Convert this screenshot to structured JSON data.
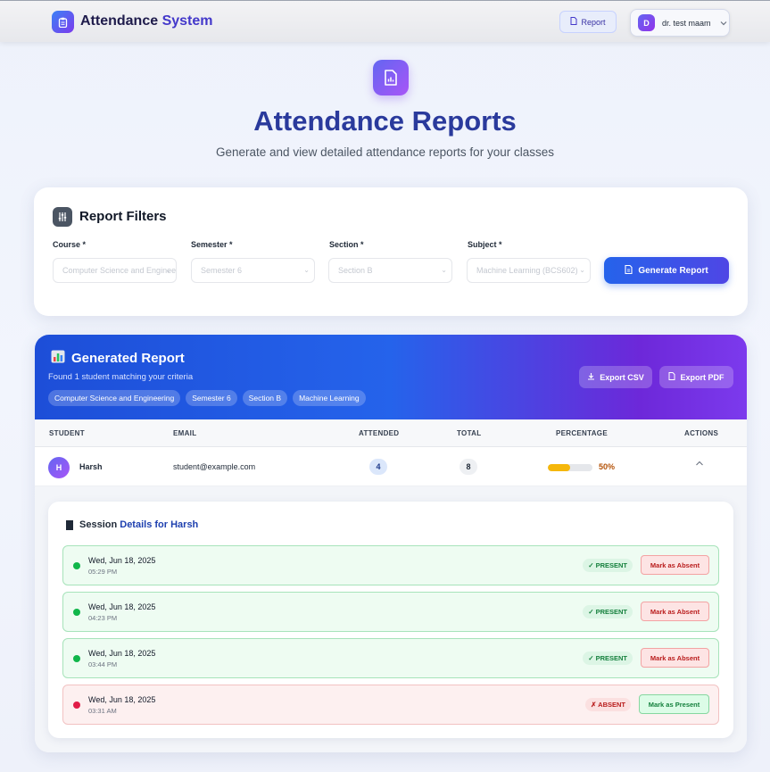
{
  "header": {
    "brand_part1": "Attendance",
    "brand_part2": "System",
    "report_button": "Report",
    "user_initial": "D",
    "user_name": "dr. test maam"
  },
  "hero": {
    "title": "Attendance Reports",
    "subtitle": "Generate and view detailed attendance reports for your classes"
  },
  "filters": {
    "title": "Report Filters",
    "fields": [
      {
        "label": "Course *",
        "value": "Computer Science and Engineering"
      },
      {
        "label": "Semester *",
        "value": "Semester 6"
      },
      {
        "label": "Section *",
        "value": "Section B"
      },
      {
        "label": "Subject *",
        "value": "Machine Learning (BCS602)"
      }
    ],
    "generate_button": "Generate Report"
  },
  "report": {
    "title": "Generated Report",
    "subtitle": "Found 1 student matching your criteria",
    "tags": [
      "Computer Science and Engineering",
      "Semester 6",
      "Section B",
      "Machine Learning"
    ],
    "export_csv": "Export CSV",
    "export_pdf": "Export PDF",
    "columns": [
      "STUDENT",
      "EMAIL",
      "ATTENDED",
      "TOTAL",
      "PERCENTAGE",
      "ACTIONS"
    ],
    "row": {
      "initial": "H",
      "name": "Harsh",
      "email": "student@example.com",
      "attended": "4",
      "total": "8",
      "percentage_text": "50%",
      "percentage_value": 50
    },
    "details": {
      "title_prefix": "Session",
      "title_suffix": "Details for Harsh",
      "sessions": [
        {
          "date": "Wed, Jun 18, 2025",
          "time": "05:29 PM",
          "status": "✓ PRESENT",
          "action": "Mark as Absent",
          "state": "present"
        },
        {
          "date": "Wed, Jun 18, 2025",
          "time": "04:23 PM",
          "status": "✓ PRESENT",
          "action": "Mark as Absent",
          "state": "present"
        },
        {
          "date": "Wed, Jun 18, 2025",
          "time": "03:44 PM",
          "status": "✓ PRESENT",
          "action": "Mark as Absent",
          "state": "present"
        },
        {
          "date": "Wed, Jun 18, 2025",
          "time": "03:31 AM",
          "status": "✗ ABSENT",
          "action": "Mark as Present",
          "state": "absent"
        }
      ]
    }
  },
  "colors": {
    "primary": "#2563eb",
    "accent": "#7c3aed",
    "present": "#15803d",
    "absent": "#b91c1c",
    "warning": "#f5b70b"
  }
}
